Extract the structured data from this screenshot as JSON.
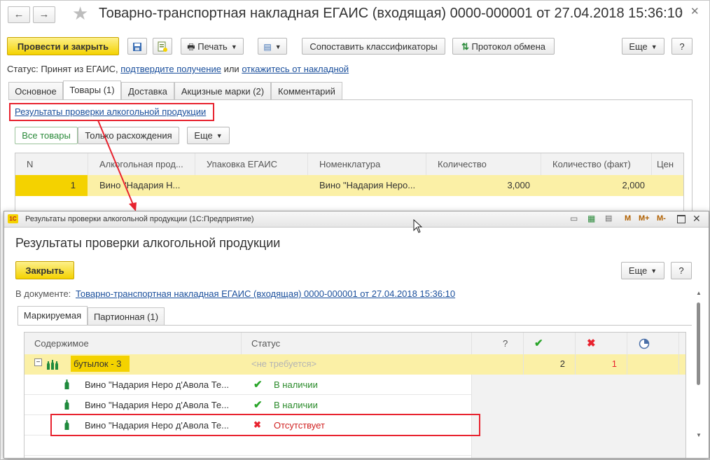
{
  "main": {
    "title": "Товарно-транспортная накладная ЕГАИС (входящая) 0000-000001 от 27.04.2018 15:36:10",
    "nav_back": "←",
    "nav_forward": "→",
    "toolbar": {
      "post_close": "Провести и закрыть",
      "print": "Печать",
      "match_classifiers": "Сопоставить классификаторы",
      "exchange_log": "Протокол обмена",
      "more": "Еще",
      "help": "?"
    },
    "status": {
      "prefix": "Статус:  Принят из ЕГАИС,",
      "confirm_link": "подтвердите получение",
      "or": "или",
      "reject_link": "откажитесь от накладной"
    },
    "tabs": [
      "Основное",
      "Товары (1)",
      "Доставка",
      "Акцизные марки (2)",
      "Комментарий"
    ],
    "check_results_link": "Результаты проверки алкогольной продукции",
    "filter": {
      "all": "Все товары",
      "diff": "Только расхождения",
      "more": "Еще"
    },
    "table": {
      "headers": [
        "N",
        "Алкогольная прод...",
        "Упаковка ЕГАИС",
        "Номенклатура",
        "Количество",
        "Количество (факт)",
        "Цен"
      ],
      "row": [
        "1",
        "Вино \"Надария Н...",
        "",
        "Вино \"Надария Неро...",
        "3,000",
        "2,000",
        ""
      ]
    }
  },
  "dialog": {
    "window_title": "Результаты проверки алкогольной продукции  (1С:Предприятие)",
    "window_controls": [
      "M",
      "M+",
      "M-"
    ],
    "heading": "Результаты проверки алкогольной продукции",
    "close": "Закрыть",
    "more": "Еще",
    "help": "?",
    "doc_label": "В документе:",
    "doc_link": "Товарно-транспортная накладная ЕГАИС (входящая) 0000-000001 от 27.04.2018 15:36:10",
    "tabs": [
      "Маркируемая",
      "Партионная (1)"
    ],
    "table": {
      "headers": [
        "Содержимое",
        "Статус",
        "?"
      ],
      "group": {
        "label": "бутылок -  3",
        "status": "<не требуется>",
        "ok": "2",
        "missing": "1"
      },
      "rows": [
        {
          "name": "Вино \"Надария Неро д'Авола Те...",
          "status": "В наличии",
          "kind": "ok"
        },
        {
          "name": "Вино \"Надария Неро д'Авола Те...",
          "status": "В наличии",
          "kind": "ok"
        },
        {
          "name": "Вино \"Надария Неро д'Авола Те...",
          "status": "Отсутствует",
          "kind": "missing"
        }
      ]
    }
  },
  "colors": {
    "accent_yellow": "#f4d200",
    "link": "#1a4f9c",
    "highlight_row": "#fbf0a6",
    "error_red": "#e8232f",
    "ok_green": "#2aa52a"
  }
}
